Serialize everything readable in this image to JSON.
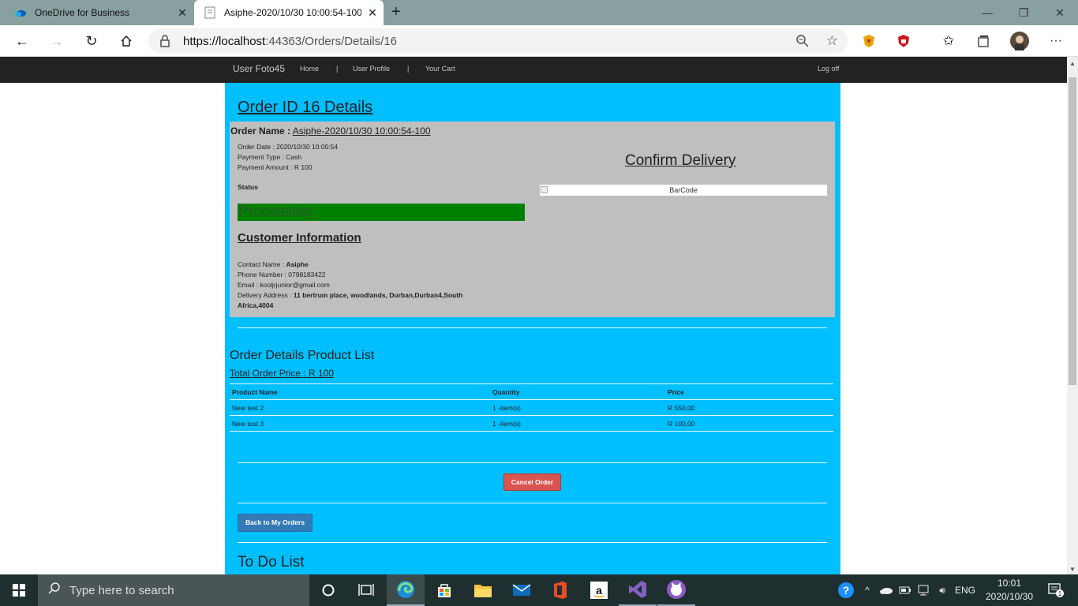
{
  "browser": {
    "tabs": [
      {
        "title": "OneDrive for Business",
        "active": false
      },
      {
        "title": "Asiphe-2020/10/30 10:00:54-100",
        "active": true
      }
    ],
    "address": {
      "host": "https://localhost",
      "rest": ":44363/Orders/Details/16"
    }
  },
  "site_nav": {
    "brand": "User Foto45",
    "links": [
      "Home",
      "User Profile",
      "Your Cart"
    ],
    "separators": [
      "|",
      "|"
    ],
    "logoff": "Log off"
  },
  "order": {
    "page_title": "Order ID 16 Details",
    "name_label": "Order Name :",
    "name_value": "Asiphe-2020/10/30 10:00:54-100",
    "date": "Order Date : 2020/10/30 10:00:54",
    "payment_type": "Payment Type : Cash",
    "payment_amount": "Payment Amount : R 100",
    "status_label": "Status",
    "status_value": "Processing",
    "confirm_title": "Confirm Delivery",
    "barcode_alt": "BarCode"
  },
  "customer": {
    "title": "Customer Information",
    "contact_label": "Contact Name :",
    "contact_value": "Asiphe",
    "phone": "Phone Number : 0798183422",
    "email": "Email : kooljrjunior@gmail.com",
    "address_label": "Delivery Address :",
    "address_value": "11 bertrum place, woodlands, Durban,Durban4,South Africa,4004"
  },
  "products": {
    "title": "Order Details Product List",
    "total": "Total Order Price : R 100",
    "columns": [
      "Product Name",
      "Quantity",
      "Price"
    ],
    "rows": [
      [
        "New test 2",
        "1 -item(s)",
        "R 550,00"
      ],
      [
        "New test 3",
        "1 -item(s)",
        "R 100,00"
      ]
    ]
  },
  "buttons": {
    "cancel": "Cancel Order",
    "back": "Back to My Orders"
  },
  "todo_title": "To Do List",
  "taskbar": {
    "search_placeholder": "Type here to search",
    "language": "ENG",
    "time": "10:01",
    "date": "2020/10/30",
    "notification_count": "1"
  },
  "colors": {
    "content_bg": "#00bfff",
    "status_green": "#008000",
    "cancel_red": "#d9534f",
    "back_blue": "#337ab7"
  }
}
